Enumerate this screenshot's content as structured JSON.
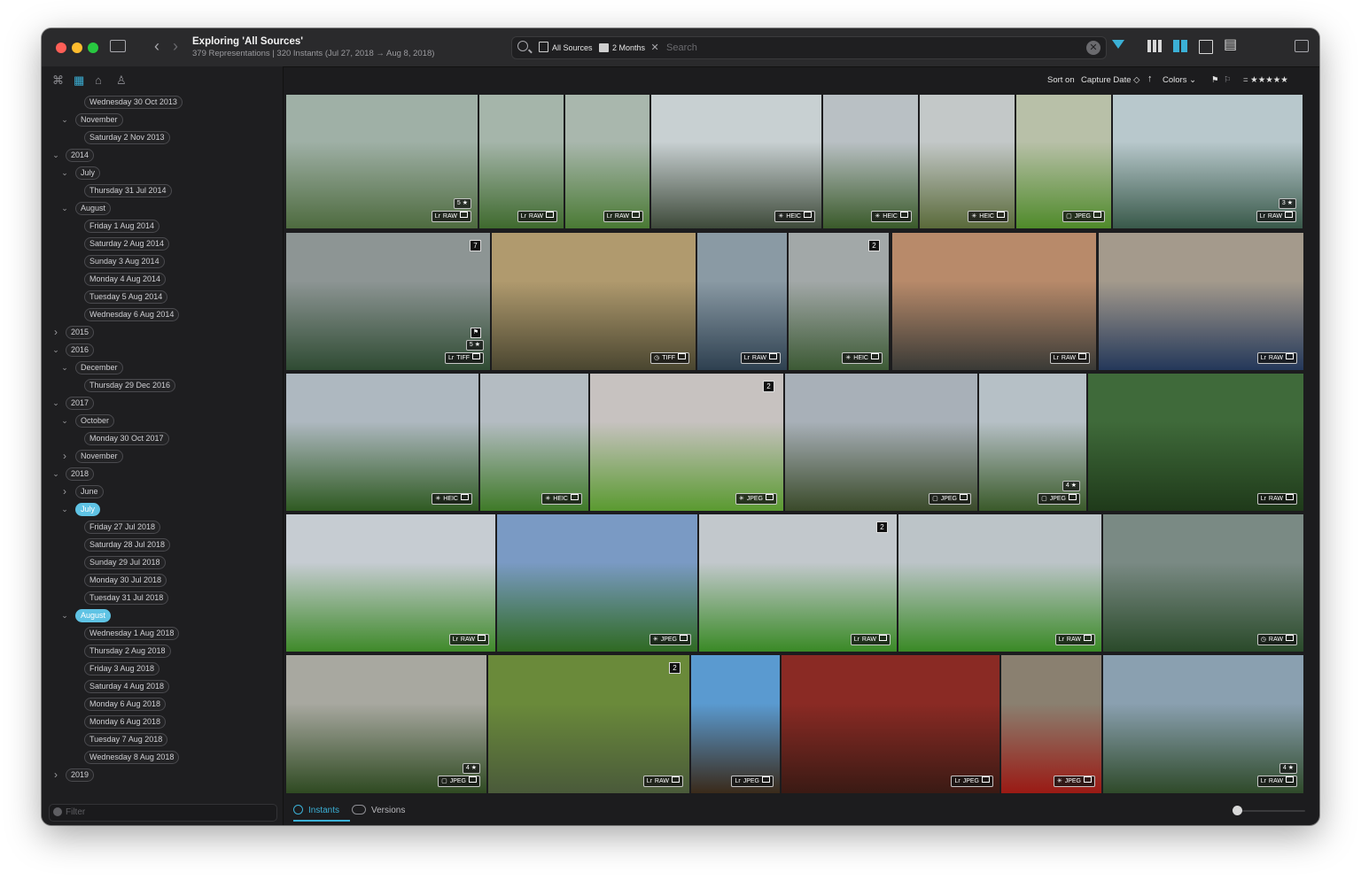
{
  "window": {
    "title": "Exploring 'All Sources'",
    "subtitle": "379 Representations | 320 Instants (Jul 27, 2018 → Aug 8, 2018)"
  },
  "search": {
    "source_chip": "All Sources",
    "range_chip": "2 Months",
    "placeholder": "Search"
  },
  "toolbar": {
    "sort_label": "Sort on",
    "sort_field": "Capture Date ◇",
    "sort_direction": "↑",
    "colors_label": "Colors",
    "rating": "= ★★★★★"
  },
  "tree": [
    {
      "label": "Wednesday 30 Oct 2013",
      "level": 3,
      "chev": ""
    },
    {
      "label": "November",
      "level": 2,
      "chev": "v"
    },
    {
      "label": "Saturday 2 Nov 2013",
      "level": 3,
      "chev": ""
    },
    {
      "label": "2014",
      "level": 1,
      "chev": "v"
    },
    {
      "label": "July",
      "level": 2,
      "chev": "v"
    },
    {
      "label": "Thursday 31 Jul 2014",
      "level": 3,
      "chev": ""
    },
    {
      "label": "August",
      "level": 2,
      "chev": "v"
    },
    {
      "label": "Friday 1 Aug 2014",
      "level": 3,
      "chev": ""
    },
    {
      "label": "Saturday 2 Aug 2014",
      "level": 3,
      "chev": ""
    },
    {
      "label": "Sunday 3 Aug 2014",
      "level": 3,
      "chev": ""
    },
    {
      "label": "Monday 4 Aug 2014",
      "level": 3,
      "chev": ""
    },
    {
      "label": "Tuesday 5 Aug 2014",
      "level": 3,
      "chev": ""
    },
    {
      "label": "Wednesday 6 Aug 2014",
      "level": 3,
      "chev": ""
    },
    {
      "label": "2015",
      "level": 1,
      "chev": ">"
    },
    {
      "label": "2016",
      "level": 1,
      "chev": "v"
    },
    {
      "label": "December",
      "level": 2,
      "chev": "v"
    },
    {
      "label": "Thursday 29 Dec 2016",
      "level": 3,
      "chev": ""
    },
    {
      "label": "2017",
      "level": 1,
      "chev": "v"
    },
    {
      "label": "October",
      "level": 2,
      "chev": "v"
    },
    {
      "label": "Monday 30 Oct 2017",
      "level": 3,
      "chev": ""
    },
    {
      "label": "November",
      "level": 2,
      "chev": ">"
    },
    {
      "label": "2018",
      "level": 1,
      "chev": "v"
    },
    {
      "label": "June",
      "level": 2,
      "chev": ">"
    },
    {
      "label": "July",
      "level": 2,
      "chev": "v",
      "selected": true
    },
    {
      "label": "Friday 27 Jul 2018",
      "level": 3,
      "chev": ""
    },
    {
      "label": "Saturday 28 Jul 2018",
      "level": 3,
      "chev": ""
    },
    {
      "label": "Sunday 29 Jul 2018",
      "level": 3,
      "chev": ""
    },
    {
      "label": "Monday 30 Jul 2018",
      "level": 3,
      "chev": ""
    },
    {
      "label": "Tuesday 31 Jul 2018",
      "level": 3,
      "chev": ""
    },
    {
      "label": "August",
      "level": 2,
      "chev": "v",
      "selected": true
    },
    {
      "label": "Wednesday 1 Aug 2018",
      "level": 3,
      "chev": ""
    },
    {
      "label": "Thursday 2 Aug 2018",
      "level": 3,
      "chev": ""
    },
    {
      "label": "Friday 3 Aug 2018",
      "level": 3,
      "chev": ""
    },
    {
      "label": "Saturday 4 Aug 2018",
      "level": 3,
      "chev": ""
    },
    {
      "label": "Monday 6 Aug 2018",
      "level": 3,
      "chev": ""
    },
    {
      "label": "Monday 6 Aug 2018",
      "level": 3,
      "chev": ""
    },
    {
      "label": "Tuesday 7 Aug 2018",
      "level": 3,
      "chev": ""
    },
    {
      "label": "Wednesday 8 Aug 2018",
      "level": 3,
      "chev": ""
    },
    {
      "label": "2019",
      "level": 1,
      "chev": ">"
    }
  ],
  "filter": {
    "placeholder": "Filter"
  },
  "rows": [
    [
      {
        "format": "RAW",
        "src": "Lr",
        "stars": "5 ★",
        "c1": "#9fb0a6",
        "c2": "#4e6b3f"
      },
      {
        "format": "RAW",
        "src": "Lr",
        "c1": "#a5b5aa",
        "c2": "#3f6a2e"
      },
      {
        "format": "RAW",
        "src": "Lr",
        "c1": "#a9b7ad",
        "c2": "#4a7a34"
      },
      {
        "format": "HEIC",
        "src": "✳",
        "c1": "#c8d0d2",
        "c2": "#3e4a3a"
      },
      {
        "format": "HEIC",
        "src": "✳",
        "c1": "#b9c0c4",
        "c2": "#3a5a2a"
      },
      {
        "format": "HEIC",
        "src": "✳",
        "c1": "#c3c8c8",
        "c2": "#5a6a3a"
      },
      {
        "format": "JPEG",
        "src": "▢",
        "c1": "#b8c0a8",
        "c2": "#4f8a2a"
      },
      {
        "format": "RAW",
        "src": "Lr",
        "stars": "3 ★",
        "c1": "#b8c8cc",
        "c2": "#39594a"
      }
    ],
    [
      {
        "format": "TIFF",
        "src": "Lr",
        "stars": "5 ★",
        "flag": "⚑",
        "count": "7",
        "c1": "#8d9594",
        "c2": "#2f4b33"
      },
      {
        "format": "TIFF",
        "src": "◷",
        "c1": "#b09a6e",
        "c2": "#4a4630"
      },
      {
        "format": "RAW",
        "src": "Lr",
        "c1": "#8a9aa4",
        "c2": "#2e4050"
      },
      {
        "format": "HEIC",
        "src": "✳",
        "count": "2",
        "c1": "#a2a8a8",
        "c2": "#3d5a35"
      },
      {
        "format": "RAW",
        "src": "Lr",
        "c1": "#b88a6a",
        "c2": "#3a3a36"
      },
      {
        "format": "RAW",
        "src": "Lr",
        "c1": "#a49a8c",
        "c2": "#24385a"
      }
    ],
    [
      {
        "format": "HEIC",
        "src": "✳",
        "c1": "#aeb8c0",
        "c2": "#2f5a22"
      },
      {
        "format": "HEIC",
        "src": "✳",
        "c1": "#b4bcc2",
        "c2": "#3f7a28"
      },
      {
        "format": "JPEG",
        "src": "✳",
        "count": "2",
        "c1": "#c7c2c0",
        "c2": "#5a9a30"
      },
      {
        "format": "JPEG",
        "src": "▢",
        "c1": "#a8b0b8",
        "c2": "#3a4a2a"
      },
      {
        "format": "JPEG",
        "src": "▢",
        "stars": "4 ★",
        "c1": "#b6c0c6",
        "c2": "#3a5a2a"
      },
      {
        "format": "RAW",
        "src": "Lr",
        "c1": "#3f6a3a",
        "c2": "#1f3a1a"
      }
    ],
    [
      {
        "format": "RAW",
        "src": "Lr",
        "c1": "#c6ccd2",
        "c2": "#3f8a2a"
      },
      {
        "format": "JPEG",
        "src": "✳",
        "c1": "#7a9ac4",
        "c2": "#2f6a22"
      },
      {
        "format": "RAW",
        "src": "Lr",
        "count": "2",
        "c1": "#c2c8cc",
        "c2": "#3a8a26"
      },
      {
        "format": "RAW",
        "src": "Lr",
        "c1": "#bcc4c8",
        "c2": "#3a8a26"
      },
      {
        "format": "RAW",
        "src": "◷",
        "c1": "#7a8a84",
        "c2": "#2a4a2a"
      }
    ],
    [
      {
        "format": "JPEG",
        "src": "▢",
        "stars": "4 ★",
        "c1": "#a8a8a0",
        "c2": "#2f4a22"
      },
      {
        "format": "RAW",
        "src": "Lr",
        "count": "2",
        "c1": "#6a8a3a",
        "c2": "#4a5a3a"
      },
      {
        "format": "JPEG",
        "src": "Lr",
        "c1": "#5a9ad0",
        "c2": "#3a2a1a"
      },
      {
        "format": "JPEG",
        "src": "Lr",
        "c1": "#8a2a24",
        "c2": "#3a1a14"
      },
      {
        "format": "JPEG",
        "src": "✳",
        "c1": "#8a8070",
        "c2": "#9a1a14"
      },
      {
        "format": "RAW",
        "src": "Lr",
        "stars": "4 ★",
        "c1": "#8aa0b0",
        "c2": "#2f4a2a"
      }
    ]
  ],
  "bottom": {
    "instants_label": "Instants",
    "versions_label": "Versions"
  }
}
